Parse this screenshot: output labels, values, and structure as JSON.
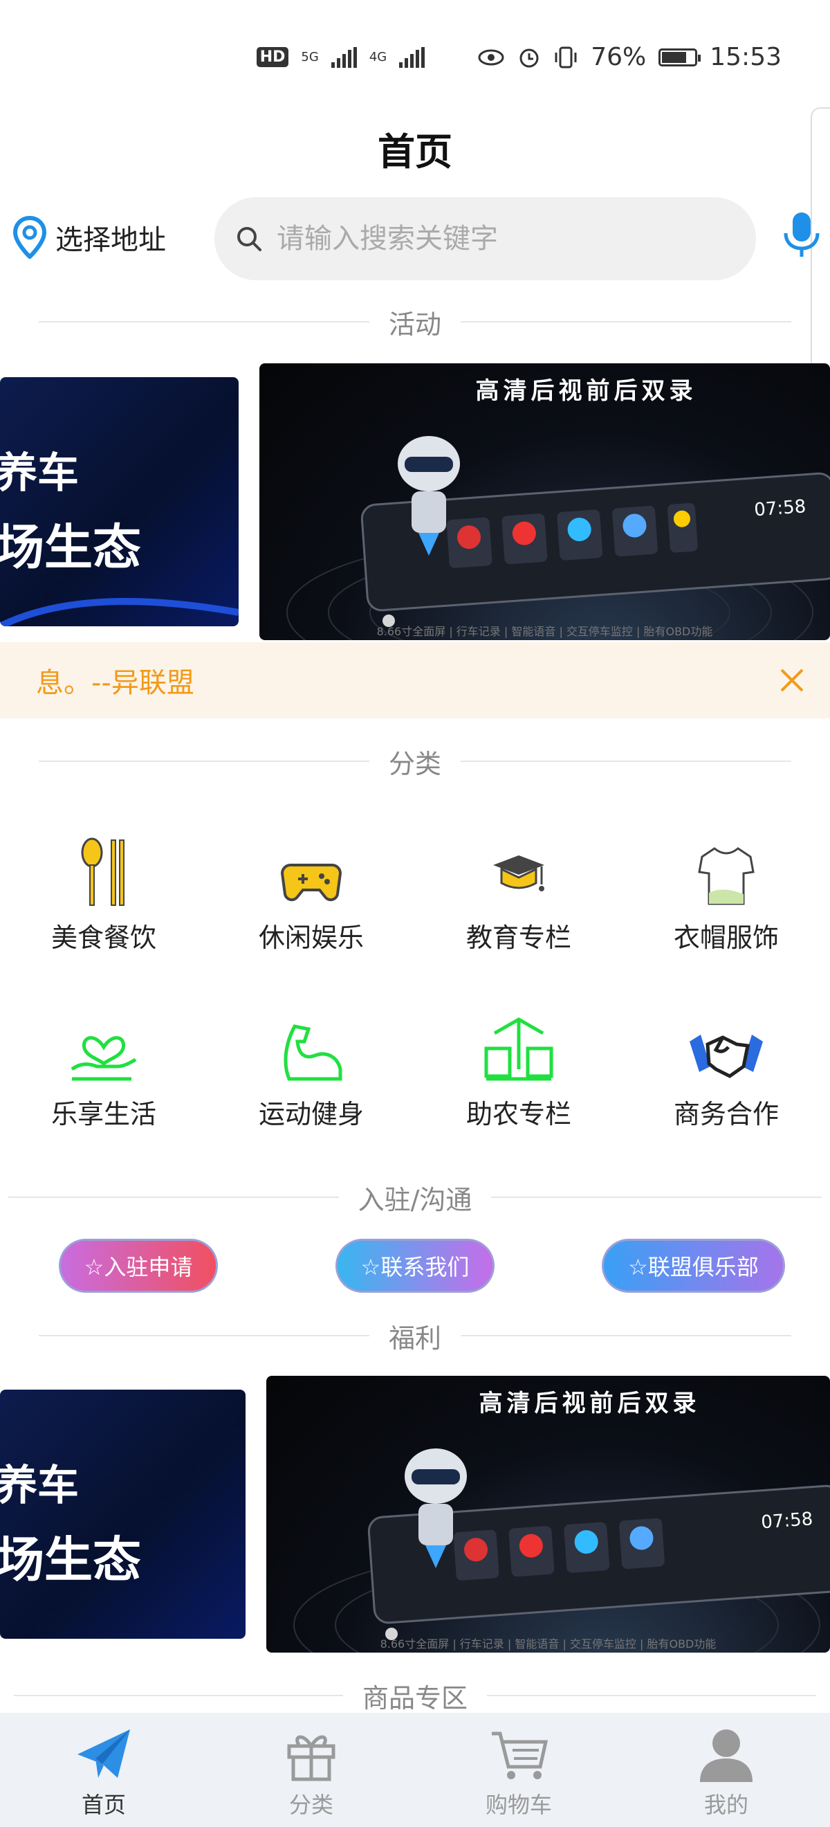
{
  "status_bar": {
    "net1": "5G",
    "net2": "4G",
    "battery": "76%",
    "battery_level": 0.76,
    "time": "15:53"
  },
  "header": {
    "title": "首页",
    "location_label": "选择地址",
    "search_placeholder": "请输入搜索关键字"
  },
  "sections": {
    "activity": "活动",
    "category": "分类",
    "join": "入驻/沟通",
    "welfare": "福利",
    "goods": "商品专区"
  },
  "banner": {
    "left_line1": "养车",
    "left_line2": "场生态",
    "right_title": "高清后视前后双录",
    "clock": "07:58",
    "caption": "8.66寸全面屏 | 行车记录 | 智能语音 | 交互停车监控 | 胎有OBD功能"
  },
  "notice": {
    "text": "息。--异联盟"
  },
  "categories": [
    {
      "label": "美食餐饮",
      "icon": "cutlery-icon"
    },
    {
      "label": "休闲娱乐",
      "icon": "gamepad-icon"
    },
    {
      "label": "教育专栏",
      "icon": "graduation-cap-icon"
    },
    {
      "label": "衣帽服饰",
      "icon": "tshirt-icon"
    },
    {
      "label": "乐享生活",
      "icon": "heart-hand-icon"
    },
    {
      "label": "运动健身",
      "icon": "muscle-arm-icon"
    },
    {
      "label": "助农专栏",
      "icon": "farm-stall-icon"
    },
    {
      "label": "商务合作",
      "icon": "handshake-icon"
    }
  ],
  "join_buttons": [
    {
      "label": "☆入驻申请",
      "color_from": "#c86de0",
      "color_to": "#f05060"
    },
    {
      "label": "☆联系我们",
      "color_from": "#38b6f0",
      "color_to": "#c56ee8"
    },
    {
      "label": "☆联盟俱乐部",
      "color_from": "#3aa0f5",
      "color_to": "#a574ea"
    }
  ],
  "nav": [
    {
      "label": "首页",
      "icon": "paper-plane-icon",
      "active": true
    },
    {
      "label": "分类",
      "icon": "gift-icon",
      "active": false
    },
    {
      "label": "购物车",
      "icon": "cart-icon",
      "active": false
    },
    {
      "label": "我的",
      "icon": "user-icon",
      "active": false
    }
  ],
  "colors": {
    "accent_orange": "#f29a1a",
    "nav_active": "#2d8ee6",
    "green": "#20e040"
  }
}
